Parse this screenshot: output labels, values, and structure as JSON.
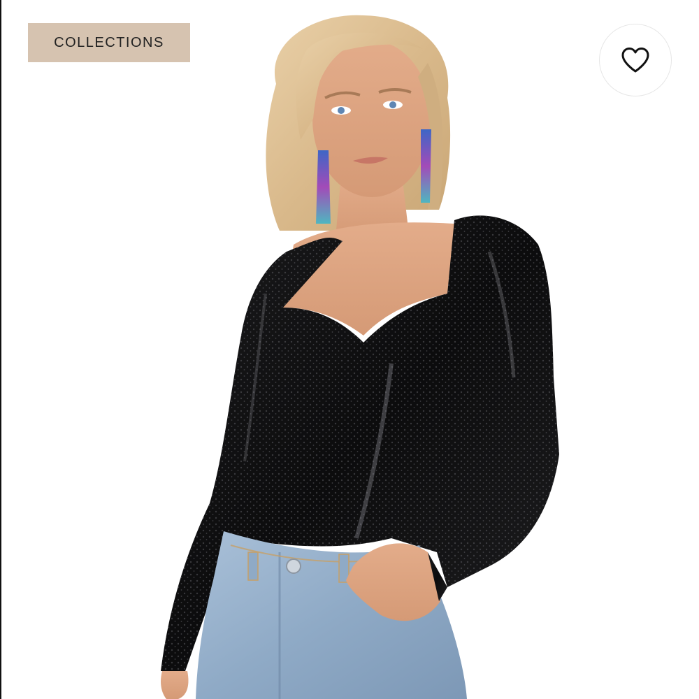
{
  "collections_button": {
    "label": "COLLECTIONS",
    "bg_color": "#d6c3b0"
  },
  "favorite_button": {
    "icon": "heart-icon"
  },
  "product_image": {
    "icon": "product-photo"
  }
}
